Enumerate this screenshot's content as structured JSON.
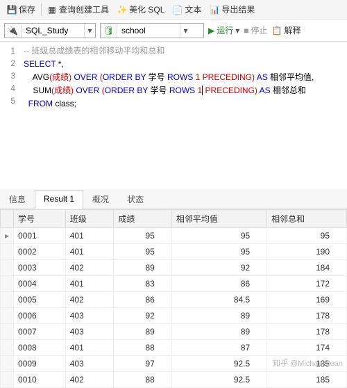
{
  "toolbar": {
    "save": "保存",
    "query_builder": "查询创建工具",
    "beautify": "美化 SQL",
    "text": "文本",
    "export": "导出结果"
  },
  "combo1": "SQL_Study",
  "combo2": "school",
  "run": "运行",
  "stop": "停止",
  "explain": "解释",
  "gutter": [
    "1",
    "2",
    "3",
    "4",
    "5"
  ],
  "code": {
    "l1": {
      "cmt": "-- 班级总成绩表的相邻移动平均和总和"
    },
    "l2": {
      "a": "SELECT",
      "b": " *,"
    },
    "l3": {
      "a": "    AVG",
      "b": "(成绩) ",
      "c": "OVER",
      "d": " (",
      "e": "ORDER BY",
      "f": " 学号 ",
      "g": "ROWS",
      "h": " ",
      "i": "1",
      "j": " PRECEDING) ",
      "k": "AS",
      "l": " 相邻平均值,"
    },
    "l4": {
      "a": "    SUM",
      "b": "(成绩) ",
      "c": "OVER",
      "d": " (",
      "e": "ORDER BY",
      "f": " 学号 ",
      "g": "ROWS",
      "h": " ",
      "i": "1",
      "j": " PRECEDING) ",
      "k": "AS",
      "l": " 相邻总和"
    },
    "l5": {
      "a": "  FROM",
      "b": " class;"
    }
  },
  "tabs": {
    "info": "信息",
    "result": "Result 1",
    "profile": "概况",
    "status": "状态"
  },
  "cols": [
    "学号",
    "班级",
    "成绩",
    "相邻平均值",
    "相邻总和"
  ],
  "chart_data": {
    "type": "table",
    "columns": [
      "学号",
      "班级",
      "成绩",
      "相邻平均值",
      "相邻总和"
    ],
    "rows": [
      [
        "0001",
        "401",
        95,
        95,
        95
      ],
      [
        "0002",
        "401",
        95,
        95,
        190
      ],
      [
        "0003",
        "402",
        89,
        92,
        184
      ],
      [
        "0004",
        "401",
        83,
        86,
        172
      ],
      [
        "0005",
        "402",
        86,
        84.5,
        169
      ],
      [
        "0006",
        "403",
        92,
        89,
        178
      ],
      [
        "0007",
        "403",
        89,
        89,
        178
      ],
      [
        "0008",
        "401",
        88,
        87,
        174
      ],
      [
        "0009",
        "403",
        97,
        92.5,
        185
      ],
      [
        "0010",
        "402",
        88,
        92.5,
        185
      ]
    ]
  },
  "watermark": "知乎 @Michael Jean"
}
